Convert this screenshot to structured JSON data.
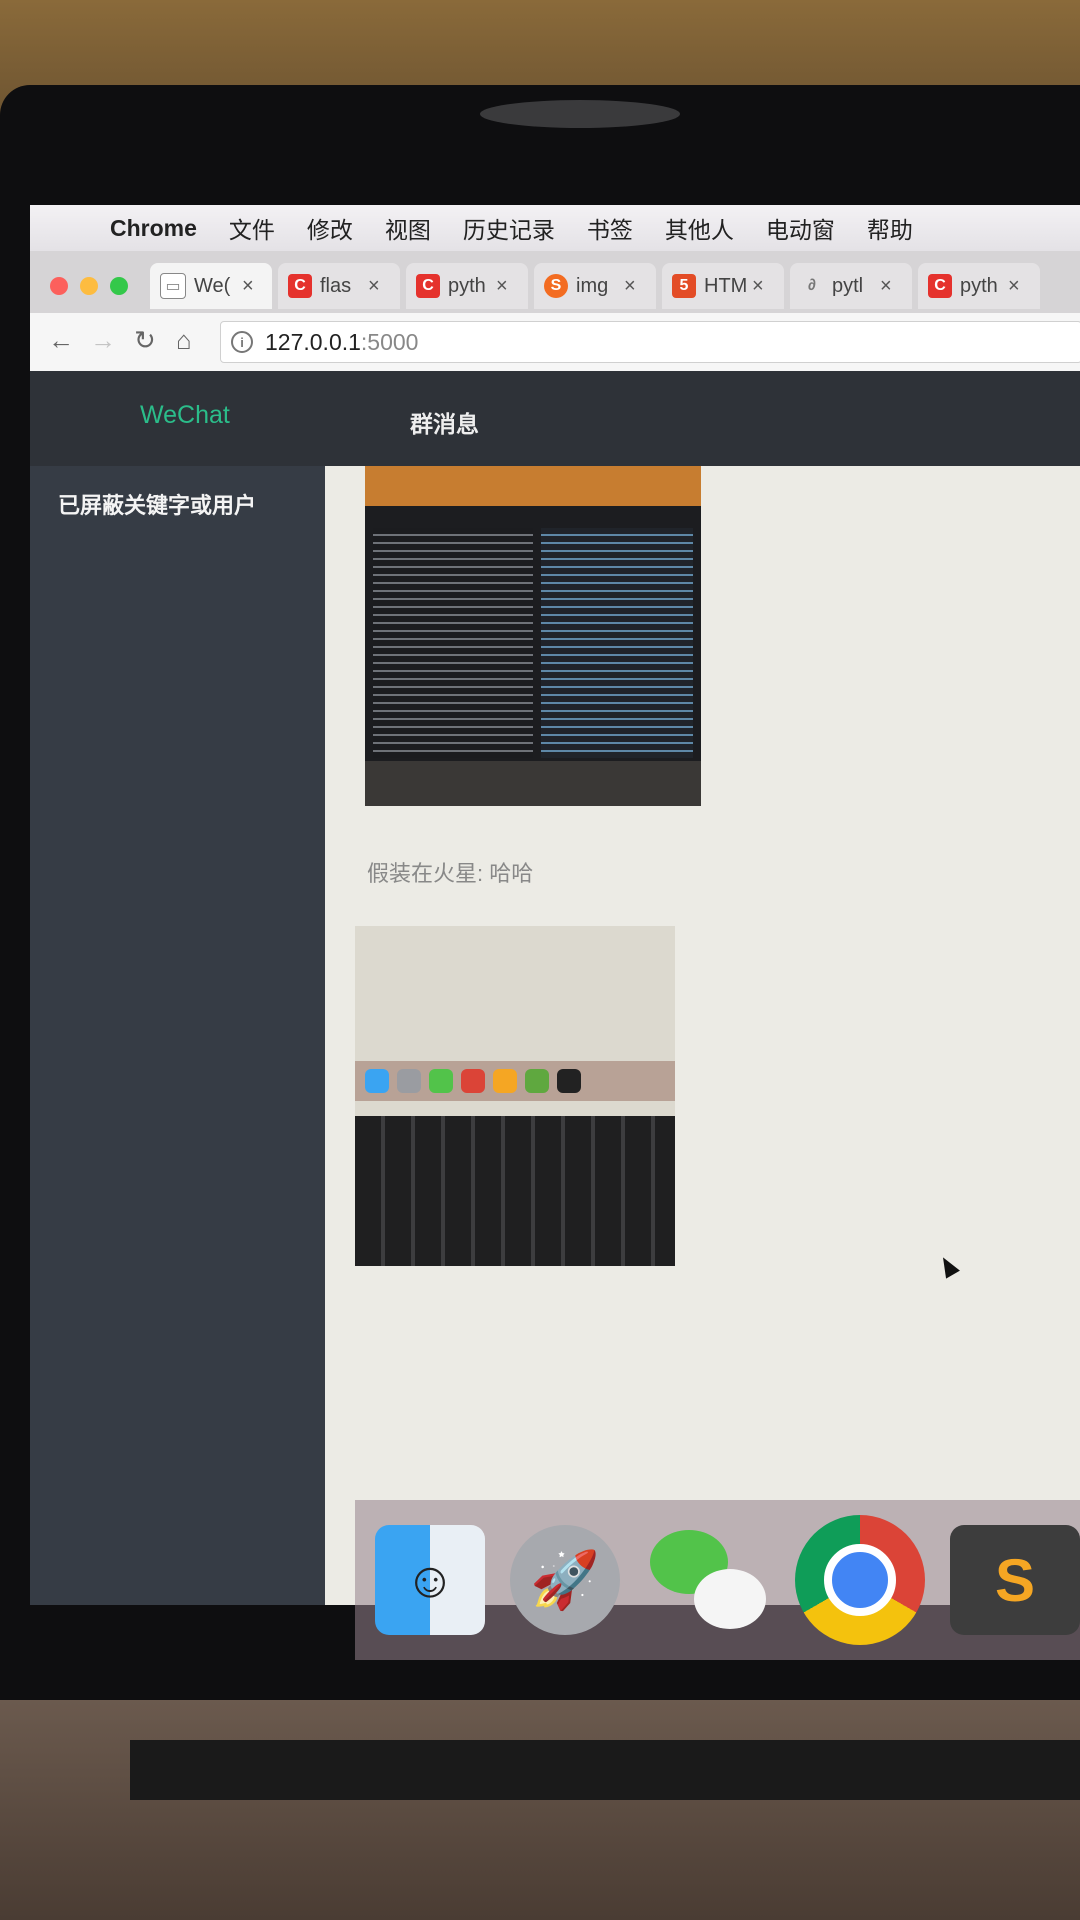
{
  "menubar": {
    "apple_icon": "apple-logo-icon",
    "items": [
      "Chrome",
      "文件",
      "修改",
      "视图",
      "历史记录",
      "书签",
      "其他人",
      "电动窗",
      "帮助"
    ]
  },
  "tabs": [
    {
      "title": "We(",
      "icon": "page-icon",
      "color": "#ffffff"
    },
    {
      "title": "flas",
      "icon": "csdn-icon",
      "color": "#e5322d"
    },
    {
      "title": "pyth",
      "icon": "csdn-icon",
      "color": "#e5322d"
    },
    {
      "title": "img",
      "icon": "sogou-icon",
      "color": "#f36c21"
    },
    {
      "title": "HTM",
      "icon": "html-icon",
      "color": "#e34c26"
    },
    {
      "title": "pytl",
      "icon": "python-icon",
      "color": "#777777"
    },
    {
      "title": "pyth",
      "icon": "csdn-icon",
      "color": "#e5322d"
    }
  ],
  "address": {
    "host": "127.0.0.1",
    "port": ":5000"
  },
  "app": {
    "brand": "WeChat",
    "header_title": "群消息",
    "sidebar_item": "已屏蔽关键字或用户",
    "message_text": "假装在火星: 哈哈"
  },
  "colors": {
    "brand": "#2bbd8a",
    "header_bg": "#2e3238",
    "sidebar_bg": "#363c45"
  }
}
